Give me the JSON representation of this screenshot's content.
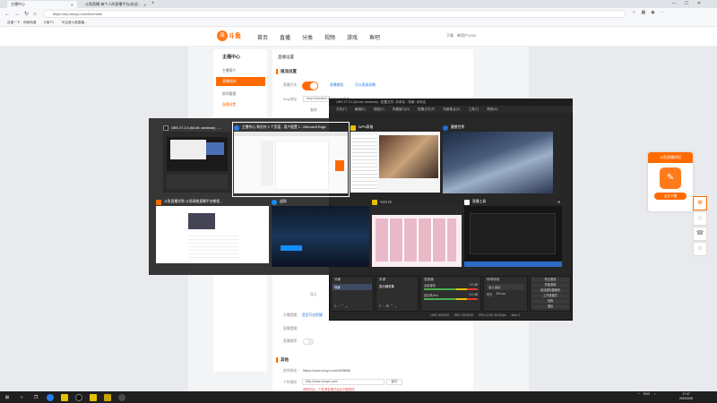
{
  "browser": {
    "tabs": [
      {
        "label": "主播中心",
        "active": true
      },
      {
        "label": "斗鱼直播-每个人的直播平台(欢迎...",
        "active": false
      }
    ],
    "new_tab": "+",
    "window_controls": [
      "—",
      "☐",
      "✕"
    ],
    "url": "https://mp.douyu.com/live/main",
    "bookmarks": [
      "百度一下，你就知道",
      "斗鱼TV",
      "TA注册斗鱼直播..."
    ]
  },
  "site": {
    "logo_mark": "斗",
    "logo_word": "斗鱼",
    "nav": [
      "首页",
      "直播",
      "分类",
      "视频",
      "游戏",
      "鱼吧"
    ],
    "user": [
      "下载",
      "新用户1234"
    ]
  },
  "sidebar": {
    "title": "主播中心",
    "items": [
      "主播简介",
      "直播相关",
      "房间管理",
      "直播设置"
    ],
    "active_index": 1
  },
  "content": {
    "breadcrumb": "直播设置",
    "section_title": "推流设置",
    "toggle_label": "直播开关：",
    "link_a": "直播教程",
    "link_b": "可以直接录播",
    "rtmp_label": "rtmp地址：",
    "rtmp_value": "rtmp://sendtc3.douyu.com/live",
    "copy_label": "复制",
    "show_label": "显示",
    "publish_label": "开播提醒：",
    "publish_link": "是否开启提醒",
    "notice_label": "直播提醒：",
    "reset_label": "直播推荐：",
    "other_title": "其他",
    "room_url_label": "房间地址：",
    "room_url": "https://www.douyu.com/505888",
    "domain_label": "个性域名：",
    "domain_value": "http://www.douyu.com/",
    "domain_btn": "保存",
    "warning": "请填写后，个性域名格式会后不能修改"
  },
  "obs": {
    "title": "OBS 27.2.4 (64-bit, windows) - 配置文件: 未命名 - 场景: 未命名",
    "menu": [
      "文件(F)",
      "编辑(E)",
      "视图(V)",
      "停靠窗口(D)",
      "配置文件(P)",
      "场景集合(S)",
      "工具(T)",
      "帮助(H)"
    ],
    "panels": [
      "场景",
      "来源",
      "混音器",
      "转场特效",
      "控件"
    ],
    "scene_item": "场景",
    "source_item": "显示器采集",
    "audio_tracks": [
      "桌面音频",
      "麦克风/Aux"
    ],
    "audio_db": [
      "0.0 dB",
      "0.0 dB"
    ],
    "transition": "淡入淡出",
    "duration_label": "时长",
    "duration_value": "300 ms",
    "controls": [
      "停止推流",
      "开始录制",
      "启动虚拟摄像机",
      "工作室模式",
      "设置",
      "退出"
    ],
    "status": [
      "LIVE: 00:00:00",
      "REC: 00:00:00",
      "CPU: 3.2%, 30.00 fps",
      "kb/s: 0"
    ]
  },
  "switcher": {
    "windows": [
      {
        "title": "OBS 27.2.4 (64-bit, windows) - ...",
        "icon_color": "#222222",
        "selected": false
      },
      {
        "title": "主播中心 和另外 1 个页面 - 用户配置 1 - Microsoft Edge",
        "icon_color": "#2b7de9",
        "selected": true
      },
      {
        "title": "WPS表格",
        "icon_color": "#e5c100",
        "selected": false
      },
      {
        "title": "魔兽世界",
        "icon_color": "#1a6fd0",
        "selected": false
      },
      {
        "title": "斗鱼直播学院-斗鱼网络直播平台教程...",
        "icon_color": "#ff6a00",
        "selected": false
      },
      {
        "title": "战网",
        "icon_color": "#148eff",
        "selected": false
      },
      {
        "title": "YYS 72",
        "icon_color": "#e5c100",
        "selected": false
      },
      {
        "title": "直播工具",
        "icon_color": "#ffffff",
        "selected": false
      }
    ]
  },
  "promo": {
    "header": "斗鱼直播伴侣",
    "button": "点击下载"
  },
  "side_fabs": [
    "⊕",
    "⌂",
    "☎",
    "☺"
  ],
  "taskbar": {
    "tray": [
      "^",
      "ENG",
      "♪"
    ],
    "time": "17:47",
    "date": "2022/10/8"
  }
}
